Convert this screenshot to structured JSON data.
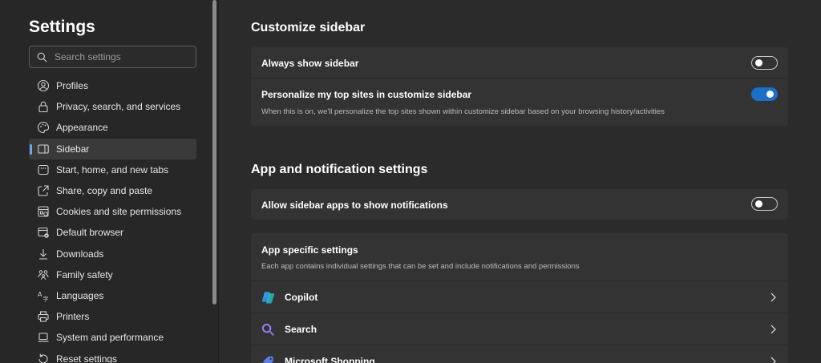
{
  "sidebar": {
    "title": "Settings",
    "search_placeholder": "Search settings",
    "items": [
      {
        "label": "Profiles",
        "icon": "person-icon"
      },
      {
        "label": "Privacy, search, and services",
        "icon": "lock-icon"
      },
      {
        "label": "Appearance",
        "icon": "palette-icon"
      },
      {
        "label": "Sidebar",
        "icon": "sidebar-icon",
        "active": true
      },
      {
        "label": "Start, home, and new tabs",
        "icon": "home-tabs-icon"
      },
      {
        "label": "Share, copy and paste",
        "icon": "share-icon"
      },
      {
        "label": "Cookies and site permissions",
        "icon": "cookie-permissions-icon"
      },
      {
        "label": "Default browser",
        "icon": "default-browser-icon"
      },
      {
        "label": "Downloads",
        "icon": "download-icon"
      },
      {
        "label": "Family safety",
        "icon": "family-icon"
      },
      {
        "label": "Languages",
        "icon": "languages-icon"
      },
      {
        "label": "Printers",
        "icon": "printer-icon"
      },
      {
        "label": "System and performance",
        "icon": "laptop-icon"
      },
      {
        "label": "Reset settings",
        "icon": "reset-icon"
      }
    ]
  },
  "customize": {
    "title": "Customize sidebar",
    "always_show": {
      "label": "Always show sidebar",
      "enabled": false
    },
    "personalize": {
      "label": "Personalize my top sites in customize sidebar",
      "description": "When this is on, we'll personalize the top sites shown within customize sidebar based on your browsing history/activities",
      "enabled": true
    }
  },
  "apps": {
    "title": "App and notification settings",
    "allow_notifications": {
      "label": "Allow sidebar apps to show notifications",
      "enabled": false
    },
    "specific": {
      "title": "App specific settings",
      "description": "Each app contains individual settings that can be set and include notifications and permissions"
    },
    "list": [
      {
        "label": "Copilot",
        "icon": "copilot-icon"
      },
      {
        "label": "Search",
        "icon": "search-magnifier-icon"
      },
      {
        "label": "Microsoft Shopping",
        "icon": "shopping-tag-icon"
      }
    ]
  },
  "colors": {
    "accent": "#1a6fc9",
    "active_indicator": "#6aa8e8",
    "background": "#2b2b2b",
    "card": "#333333"
  }
}
